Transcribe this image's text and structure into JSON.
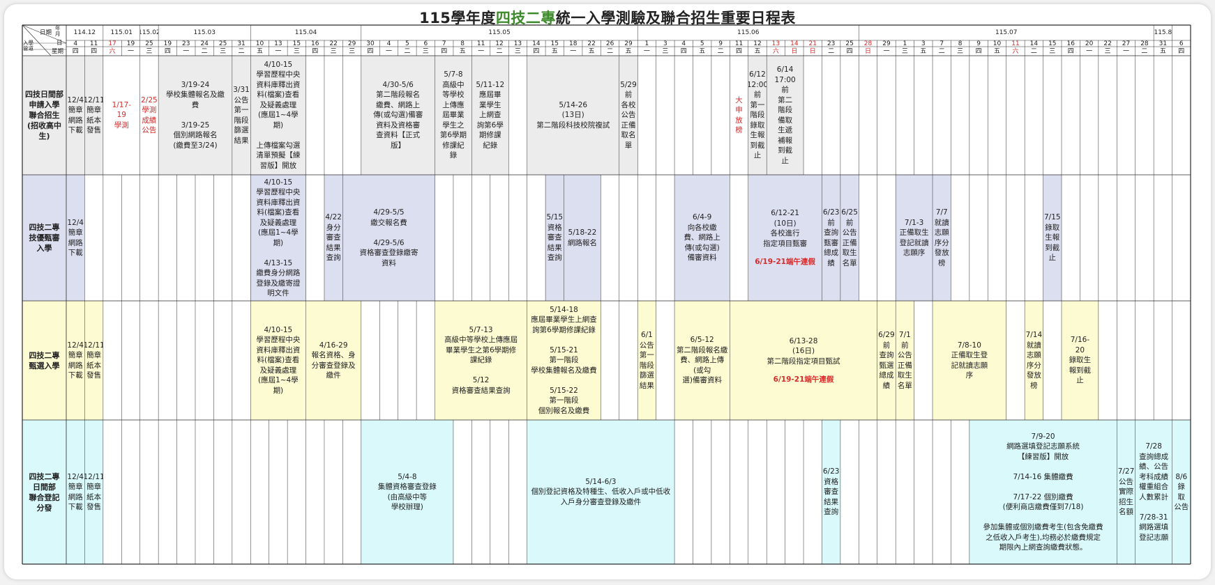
{
  "title": {
    "prefix": "115學年度",
    "green": "四技二專",
    "suffix": "統一入學測驗及聯合招生重要日程表"
  },
  "corner": {
    "a": "日期",
    "b": "年月",
    "c": "日",
    "d": "入學管道",
    "e": "星期"
  },
  "colors": {
    "grey": "#ececec",
    "blue": "#dcdff0",
    "yellow": "#fdfbd2",
    "cyan": "#d9f9fb",
    "line": "#2a2a2a",
    "red": "#d62b2b",
    "green": "#3d8a2a"
  },
  "months": [
    {
      "label": "114.12",
      "span": 2
    },
    {
      "label": "115.01",
      "span": 2
    },
    {
      "label": "115.02",
      "span": 1
    },
    {
      "label": "115.03",
      "span": 5
    },
    {
      "label": "115.04",
      "span": 6
    },
    {
      "label": "115.05",
      "span": 15
    },
    {
      "label": "115.06",
      "span": 12
    },
    {
      "label": "115.07",
      "span": 16
    },
    {
      "label": "115.8",
      "span": 1
    }
  ],
  "days": [
    {
      "d": "4",
      "w": "四"
    },
    {
      "d": "11",
      "w": "四"
    },
    {
      "d": "17",
      "w": "六",
      "red": true
    },
    {
      "d": "19",
      "w": "一"
    },
    {
      "d": "25",
      "w": "三"
    },
    {
      "d": "19",
      "w": "四"
    },
    {
      "d": "23",
      "w": "一"
    },
    {
      "d": "24",
      "w": "二"
    },
    {
      "d": "25",
      "w": "三"
    },
    {
      "d": "31",
      "w": "二"
    },
    {
      "d": "10",
      "w": "五"
    },
    {
      "d": "13",
      "w": "一"
    },
    {
      "d": "15",
      "w": "三"
    },
    {
      "d": "16",
      "w": "四"
    },
    {
      "d": "22",
      "w": "三"
    },
    {
      "d": "29",
      "w": "三"
    },
    {
      "d": "30",
      "w": "四"
    },
    {
      "d": "4",
      "w": "一"
    },
    {
      "d": "5",
      "w": "二"
    },
    {
      "d": "6",
      "w": "三"
    },
    {
      "d": "7",
      "w": "四"
    },
    {
      "d": "8",
      "w": "五"
    },
    {
      "d": "11",
      "w": "一"
    },
    {
      "d": "12",
      "w": "二"
    },
    {
      "d": "13",
      "w": "三"
    },
    {
      "d": "14",
      "w": "四"
    },
    {
      "d": "15",
      "w": "五"
    },
    {
      "d": "18",
      "w": "一"
    },
    {
      "d": "22",
      "w": "五"
    },
    {
      "d": "26",
      "w": "二"
    },
    {
      "d": "29",
      "w": "五"
    },
    {
      "d": "1",
      "w": "一"
    },
    {
      "d": "3",
      "w": "三"
    },
    {
      "d": "4",
      "w": "四"
    },
    {
      "d": "5",
      "w": "五"
    },
    {
      "d": "9",
      "w": "二"
    },
    {
      "d": "11",
      "w": "四"
    },
    {
      "d": "12",
      "w": "五"
    },
    {
      "d": "13",
      "w": "六",
      "red": true
    },
    {
      "d": "14",
      "w": "日",
      "red": true
    },
    {
      "d": "21",
      "w": "日",
      "red": true
    },
    {
      "d": "23",
      "w": "二"
    },
    {
      "d": "25",
      "w": "四"
    },
    {
      "d": "28",
      "w": "日",
      "red": true
    },
    {
      "d": "29",
      "w": "一"
    },
    {
      "d": "1",
      "w": "三"
    },
    {
      "d": "3",
      "w": "五"
    },
    {
      "d": "7",
      "w": "二"
    },
    {
      "d": "8",
      "w": "三"
    },
    {
      "d": "9",
      "w": "四"
    },
    {
      "d": "10",
      "w": "五"
    },
    {
      "d": "11",
      "w": "六",
      "red": true
    },
    {
      "d": "14",
      "w": "二"
    },
    {
      "d": "15",
      "w": "三"
    },
    {
      "d": "16",
      "w": "四"
    },
    {
      "d": "20",
      "w": "一"
    },
    {
      "d": "22",
      "w": "三"
    },
    {
      "d": "27",
      "w": "一"
    },
    {
      "d": "28",
      "w": "二"
    },
    {
      "d": "31",
      "w": "五"
    },
    {
      "d": "6",
      "w": "四"
    }
  ],
  "rows": [
    {
      "label": "四技日間部\n申請入學\n聯合招生\n(招收高中\n生)",
      "bg": "grey"
    },
    {
      "label": "四技二專\n技優甄審\n入學",
      "bg": "blue"
    },
    {
      "label": "四技二專\n甄選入學",
      "bg": "yellow"
    },
    {
      "label": "四技二專\n日間部\n聯合登記\n分發",
      "bg": "cyan"
    }
  ],
  "events": [
    {
      "row": 0,
      "c": 0,
      "s": 1,
      "text": "12/4\n簡章\n網路\n下載"
    },
    {
      "row": 0,
      "c": 1,
      "s": 1,
      "text": "12/11\n簡章\n紙本\n發售"
    },
    {
      "row": 0,
      "c": 2,
      "s": 2,
      "text": "1/17-\n19\n學測",
      "red": true,
      "nobg": true
    },
    {
      "row": 0,
      "c": 4,
      "s": 1,
      "text": "2/25\n學測\n成績\n公告",
      "red": true,
      "nobg": true
    },
    {
      "row": 0,
      "c": 5,
      "s": 4,
      "text": "3/19-24\n學校集體報名及繳\n費\n\n3/19-25\n個別網路報名\n(繳費至3/24)"
    },
    {
      "row": 0,
      "c": 9,
      "s": 1,
      "text": "3/31\n公告\n第一\n階段\n篩選\n結果"
    },
    {
      "row": 0,
      "c": 10,
      "s": 3,
      "text": "4/10-15\n學習歷程中央\n資料庫釋出資\n料(檔案)查看\n及疑義處理\n(應屆1~4學\n期)\n\n上傳檔案勾選\n清單預擬【練\n習版】開放"
    },
    {
      "row": 0,
      "c": 16,
      "s": 4,
      "text": "4/30-5/6\n第二階段報名\n繳費、網路上\n傳(或勾選)備審\n資料及資格審\n查資料【正式\n版】"
    },
    {
      "row": 0,
      "c": 20,
      "s": 2,
      "text": "5/7-8\n高級中\n等學校\n上傳應\n屆畢業\n學生之\n第6學期\n修課紀\n錄"
    },
    {
      "row": 0,
      "c": 22,
      "s": 2,
      "text": "5/11-12\n應屆畢\n業學生\n上網查\n詢第6學\n期修課\n紀錄"
    },
    {
      "row": 0,
      "c": 25,
      "s": 5,
      "text": "5/14-26\n(13日)\n第二階段科技校院複試"
    },
    {
      "row": 0,
      "c": 30,
      "s": 1,
      "text": "5/29\n前\n各校\n公告\n正備\n取名\n單"
    },
    {
      "row": 0,
      "c": 36,
      "s": 1,
      "text": "大\n申\n放\n榜",
      "red": true,
      "nobg": true
    },
    {
      "row": 0,
      "c": 37,
      "s": 1,
      "text": "6/12\n12:00\n前\n第一\n階段\n錄取\n生報\n到截\n止"
    },
    {
      "row": 0,
      "c": 38,
      "s": 2,
      "text": "6/14\n17:00\n前\n第二\n階段\n備取\n生遞\n補報\n到截\n止"
    },
    {
      "row": 1,
      "c": 0,
      "s": 1,
      "text": "12/4\n簡章\n網路\n下載"
    },
    {
      "row": 1,
      "c": 10,
      "s": 3,
      "text": "4/10-15\n學習歷程中央\n資料庫釋出資\n料(檔案)查看\n及疑義處理\n(應屆1~4學\n期)\n\n4/13-15\n繳費身分網路\n登錄及繳寄證\n明文件"
    },
    {
      "row": 1,
      "c": 14,
      "s": 1,
      "text": "4/22\n身分\n審查\n結果\n查詢"
    },
    {
      "row": 1,
      "c": 15,
      "s": 5,
      "text": "4/29-5/5\n繳交報名費\n\n4/29-5/6\n資格審查登錄繳寄\n資料"
    },
    {
      "row": 1,
      "c": 26,
      "s": 1,
      "text": "5/15\n資格\n審查\n結果\n查詢"
    },
    {
      "row": 1,
      "c": 27,
      "s": 2,
      "text": "5/18-22\n網路報名"
    },
    {
      "row": 1,
      "c": 33,
      "s": 3,
      "text": "6/4-9\n向各校繳\n費、網路上\n傳(或勾選)\n備審資料"
    },
    {
      "row": 1,
      "c": 37,
      "s": 4,
      "text": "6/12-21\n(10日)\n各校進行\n指定項目甄審",
      "extra": "6/19-21端午連假"
    },
    {
      "row": 1,
      "c": 41,
      "s": 1,
      "text": "6/23\n前\n查詢\n甄審\n總成\n績"
    },
    {
      "row": 1,
      "c": 42,
      "s": 1,
      "text": "6/25\n前\n公告\n正備\n取生\n名單"
    },
    {
      "row": 1,
      "c": 45,
      "s": 2,
      "text": "7/1-3\n正備取生\n登記就讀\n志願序"
    },
    {
      "row": 1,
      "c": 47,
      "s": 1,
      "text": "7/7\n就讀\n志願\n序分\n發放\n榜"
    },
    {
      "row": 1,
      "c": 53,
      "s": 1,
      "text": "7/15\n錄取\n生報\n到截\n止"
    },
    {
      "row": 2,
      "c": 0,
      "s": 1,
      "text": "12/4\n簡章\n網路\n下載"
    },
    {
      "row": 2,
      "c": 1,
      "s": 1,
      "text": "12/11\n簡章\n紙本\n發售"
    },
    {
      "row": 2,
      "c": 10,
      "s": 3,
      "text": "4/10-15\n學習歷程中央\n資料庫釋出資\n料(檔案)查看\n及疑義處理\n(應屆1~4學\n期)"
    },
    {
      "row": 2,
      "c": 13,
      "s": 3,
      "text": "4/16-29\n報名資格、身\n分審查登錄及\n繳件"
    },
    {
      "row": 2,
      "c": 20,
      "s": 5,
      "text": "5/7-13\n高級中等學校上傳應屆\n畢業學生之第6學期修\n課紀錄\n\n5/12\n資格審查結果查詢"
    },
    {
      "row": 2,
      "c": 25,
      "s": 4,
      "text": "5/14-18\n應屆畢業學生上網查\n詢第6學期修課紀錄\n\n5/15-21\n第一階段\n學校集體報名及繳費\n\n5/15-22\n第一階段\n個別報名及繳費"
    },
    {
      "row": 2,
      "c": 31,
      "s": 1,
      "text": "6/1\n公告\n第一\n階段\n篩選\n結果"
    },
    {
      "row": 2,
      "c": 33,
      "s": 3,
      "text": "6/5-12\n第二階段報名繳\n費、網路上傳(或勾\n選)備審資料"
    },
    {
      "row": 2,
      "c": 36,
      "s": 8,
      "text": "6/13-28\n(16日)\n第二階段指定項目甄試",
      "extra": "6/19-21端午連假"
    },
    {
      "row": 2,
      "c": 44,
      "s": 1,
      "text": "6/29\n前\n查詢\n甄選\n總成\n績"
    },
    {
      "row": 2,
      "c": 45,
      "s": 1,
      "text": "7/1\n前\n公告\n正備\n取生\n名單"
    },
    {
      "row": 2,
      "c": 47,
      "s": 4,
      "text": "7/8-10\n正備取生登\n記就讀志願\n序"
    },
    {
      "row": 2,
      "c": 52,
      "s": 1,
      "text": "7/14\n就讀\n志願\n序分\n發放\n榜"
    },
    {
      "row": 2,
      "c": 54,
      "s": 2,
      "text": "7/16-\n20\n錄取生\n報到截\n止"
    },
    {
      "row": 3,
      "c": 0,
      "s": 1,
      "text": "12/4\n簡章\n網路\n下載"
    },
    {
      "row": 3,
      "c": 1,
      "s": 1,
      "text": "12/11\n簡章\n紙本\n發售"
    },
    {
      "row": 3,
      "c": 16,
      "s": 5,
      "text": "5/4-8\n集體資格審查登錄\n(由高級中等\n學校辦理)"
    },
    {
      "row": 3,
      "c": 25,
      "s": 8,
      "text": "5/14-6/3\n個別登記資格及特種生、低收入戶或中低收\n入戶身分審查登錄及繳件"
    },
    {
      "row": 3,
      "c": 41,
      "s": 1,
      "text": "6/23\n資格\n審查\n結果\n查詢"
    },
    {
      "row": 3,
      "c": 49,
      "s": 8,
      "text": "7/9-20\n網路選填登記志願系統\n【練習版】開放\n\n7/14-16  集體繳費\n\n7/17-22  個別繳費\n(便利商店繳費僅到7/18)\n\n參加集體或個別繳費考生(包含免繳費\n之低收入戶考生),均務必於繳費規定\n期限內上網查詢繳費狀態。"
    },
    {
      "row": 3,
      "c": 57,
      "s": 1,
      "text": "7/27\n公告\n實際\n招生\n名額"
    },
    {
      "row": 3,
      "c": 58,
      "s": 2,
      "text": "7/28\n查詢總成\n績、公告\n考科成績\n權重組合\n人數累計\n\n7/28-31\n網路選填\n登記志願"
    },
    {
      "row": 3,
      "c": 60,
      "s": 1,
      "text": "8/6\n錄\n取\n公告"
    }
  ]
}
